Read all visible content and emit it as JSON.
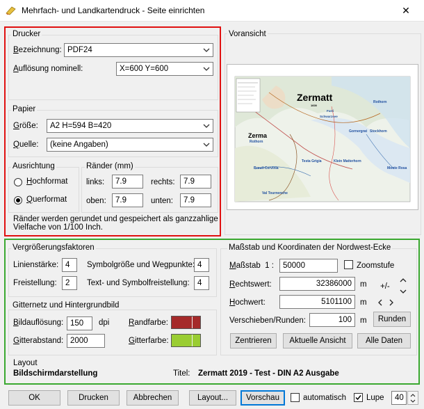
{
  "window": {
    "title": "Mehrfach- und Landkartendruck - Seite einrichten",
    "close_glyph": "✕"
  },
  "drucker": {
    "title": "Drucker",
    "bezeichnung_label": "Bezeichnung:",
    "bezeichnung_value": "PDF24",
    "aufloesung_label": "Auflösung nominell:",
    "aufloesung_value": "X=600 Y=600"
  },
  "papier": {
    "title": "Papier",
    "groesse_label": "Größe:",
    "groesse_value": "A2 H=594 B=420",
    "quelle_label": "Quelle:",
    "quelle_value": "(keine Angaben)"
  },
  "ausrichtung": {
    "title": "Ausrichtung",
    "hochformat_label": "Hochformat",
    "querformat_label": "Querformat",
    "selected": "querformat"
  },
  "raender": {
    "title": "Ränder (mm)",
    "links_label": "links:",
    "links_value": "7.9",
    "rechts_label": "rechts:",
    "rechts_value": "7.9",
    "oben_label": "oben:",
    "oben_value": "7.9",
    "unten_label": "unten:",
    "unten_value": "7.9",
    "note_line1": "Ränder werden gerundet und gespeichert als ganzzahlige",
    "note_line2": "Vielfache von 1/100 Inch."
  },
  "voransicht": {
    "title": "Voransicht",
    "map_title": "Zermatt",
    "map_subtitle": "1600",
    "map_side_label": "Zerma",
    "map_places": [
      "Rothorn",
      "Gornergrat",
      "Stockhorn",
      "Testa Grigia",
      "Klein Matterhorn",
      "Breuil-Cervinia",
      "Monte Rosa",
      "Val Tournenche",
      "Furri",
      "Schwarzsee"
    ]
  },
  "vergroesserung": {
    "title": "Vergrößerungsfaktoren",
    "linienstaerke_label": "Linienstärke:",
    "linienstaerke_value": "4",
    "symbolgroesse_label": "Symbolgröße und Wegpunkte:",
    "symbolgroesse_value": "4",
    "freistellung_label": "Freistellung:",
    "freistellung_value": "2",
    "textsymbol_label": "Text- und Symbolfreistellung:",
    "textsymbol_value": "4"
  },
  "gitternetz": {
    "title": "Gitternetz und Hintergrundbild",
    "bildaufloesung_label": "Bildauflösung:",
    "bildaufloesung_value": "150",
    "bildaufloesung_unit": "dpi",
    "gitterabstand_label": "Gitterabstand:",
    "gitterabstand_value": "2000",
    "randfarbe_label": "Randfarbe:",
    "randfarbe_color": "#a52a2a",
    "gitterfarbe_label": "Gitterfarbe:",
    "gitterfarbe_color": "#9acd32"
  },
  "massstab": {
    "title": "Maßstab und Koordinaten der Nordwest-Ecke",
    "massstab_label": "Maßstab  1 :",
    "massstab_value": "50000",
    "zoomstufe_label": "Zoomstufe",
    "zoomstufe_checked": false,
    "rechtswert_label": "Rechtswert:",
    "rechtswert_value": "32386000",
    "rechtswert_unit": "m",
    "hochwert_label": "Hochwert:",
    "hochwert_value": "5101100",
    "hochwert_unit": "m",
    "verschieben_label": "Verschieben/Runden:",
    "verschieben_value": "100",
    "verschieben_unit": "m",
    "plusminus_label": "+/-",
    "runden_label": "Runden",
    "zentrieren_label": "Zentrieren",
    "aktuelle_ansicht_label": "Aktuelle Ansicht",
    "alle_daten_label": "Alle Daten"
  },
  "layout": {
    "title": "Layout",
    "mode_value": "Bildschirmdarstellung",
    "titel_label": "Titel:",
    "titel_value": "Zermatt 2019 - Test - DIN A2 Ausgabe"
  },
  "bottom": {
    "ok_label": "OK",
    "drucken_label": "Drucken",
    "abbrechen_label": "Abbrechen",
    "layout_label": "Layout...",
    "vorschau_label": "Vorschau",
    "automatisch_label": "automatisch",
    "automatisch_checked": false,
    "lupe_label": "Lupe",
    "lupe_checked": true,
    "lupe_value": "40"
  },
  "colors": {
    "red_frame": "#e01010",
    "green_frame": "#3aa830",
    "accent": "#0078d7"
  }
}
